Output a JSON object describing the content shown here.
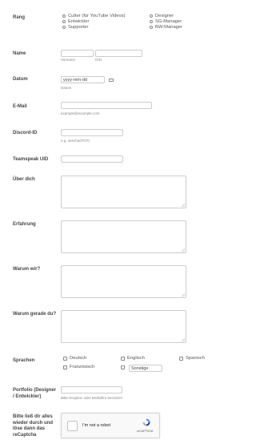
{
  "rang": {
    "label": "Rang",
    "options_col1": [
      "Cutter (für YouTube Videos)",
      "Entwickler",
      "Supporter"
    ],
    "options_col2": [
      "Designer",
      "SG-Manager",
      "BW-Manager"
    ]
  },
  "name": {
    "label": "Name",
    "first_sub": "Vorname",
    "last_sub": "IGN"
  },
  "datum": {
    "label": "Datum",
    "value": "yyyy-mm-dd",
    "sub": "Datum"
  },
  "email": {
    "label": "E-Mail",
    "sub": "example@example.com"
  },
  "discord": {
    "label": "Discord-ID",
    "sub": "e.g. seechad7070"
  },
  "teamspeak": {
    "label": "Teamspeak UID"
  },
  "ueber": {
    "label": "Über dich"
  },
  "erfahrung": {
    "label": "Erfahrung"
  },
  "warum_wir": {
    "label": "Warum wir?"
  },
  "warum_du": {
    "label": "Warum gerade du?"
  },
  "sprachen": {
    "label": "Sprachen",
    "options": [
      "Deutsch",
      "Englisch",
      "Spanisch",
      "Französisch"
    ],
    "other_value": "Sonstige"
  },
  "portfolio": {
    "label": "Portfolio (Designer / Entwickler)",
    "sub": "Bitte Dropbox oder Mediafire benutzen"
  },
  "captcha": {
    "label": "Bitte ließ dir alles wieder durch und löse dann das reCaptcha",
    "text": "I'm not a robot",
    "brand": "reCAPTCHA"
  }
}
